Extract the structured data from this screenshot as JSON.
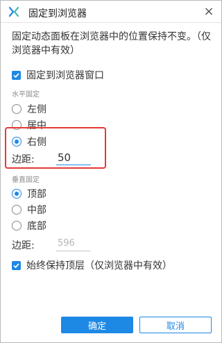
{
  "titlebar": {
    "app_icon": "axure-x-icon",
    "title": "固定到浏览器",
    "close_glyph": "×"
  },
  "description": "固定动态面板在浏览器中的位置保持不变。（仅浏览器中有效）",
  "pin_to_browser": {
    "label": "固定到浏览器窗口",
    "checked": true
  },
  "horizontal": {
    "section_label": "水平固定",
    "options": [
      {
        "label": "左侧",
        "checked": false
      },
      {
        "label": "居中",
        "checked": false
      },
      {
        "label": "右侧",
        "checked": true
      }
    ],
    "margin_label": "边距:",
    "margin_value": "50"
  },
  "vertical": {
    "section_label": "垂直固定",
    "options": [
      {
        "label": "顶部",
        "checked": true
      },
      {
        "label": "中部",
        "checked": false
      },
      {
        "label": "底部",
        "checked": false
      }
    ],
    "margin_label": "边距:",
    "margin_value": "596"
  },
  "always_on_top": {
    "label": "始终保持顶层（仅浏览器中有效）",
    "checked": true
  },
  "buttons": {
    "ok": "确定",
    "cancel": "取消"
  },
  "colors": {
    "accent": "#1e88e5",
    "highlight": "#e53935"
  }
}
